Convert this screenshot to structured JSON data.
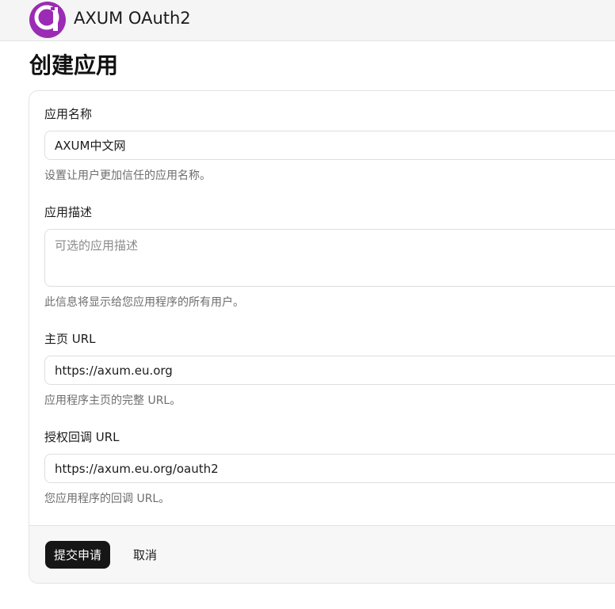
{
  "header": {
    "logo_icon": "axum-a-logo-icon",
    "brand_color": "#9b2bb4",
    "title": "AXUM OAuth2"
  },
  "page": {
    "title": "创建应用"
  },
  "form": {
    "app_name": {
      "label": "应用名称",
      "value": "AXUM中文网",
      "help": "设置让用户更加信任的应用名称。"
    },
    "app_description": {
      "label": "应用描述",
      "placeholder": "可选的应用描述",
      "value": "",
      "help": "此信息将显示给您应用程序的所有用户。"
    },
    "homepage_url": {
      "label": "主页 URL",
      "value": "https://axum.eu.org",
      "help": "应用程序主页的完整 URL。"
    },
    "callback_url": {
      "label": "授权回调 URL",
      "value": "https://axum.eu.org/oauth2",
      "help": "您应用程序的回调 URL。"
    },
    "submit_label": "提交申请",
    "cancel_label": "取消"
  }
}
